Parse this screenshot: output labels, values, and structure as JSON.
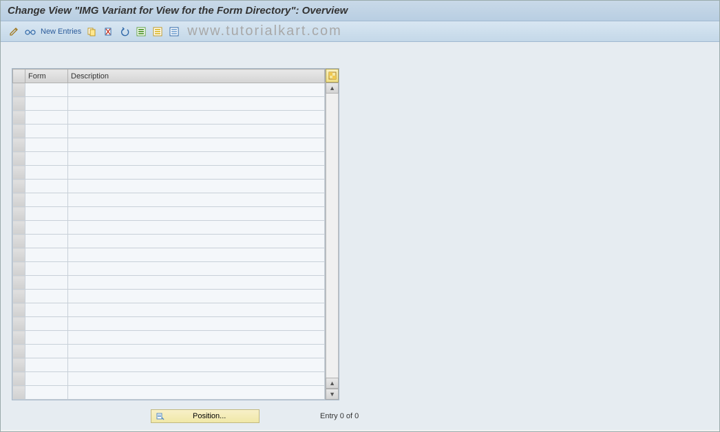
{
  "header": {
    "title": "Change View \"IMG Variant for View for the Form Directory\": Overview"
  },
  "toolbar": {
    "new_entries_label": "New Entries"
  },
  "watermark": "www.tutorialkart.com",
  "table": {
    "columns": {
      "form": "Form",
      "description": "Description"
    },
    "row_count": 23
  },
  "footer": {
    "position_label": "Position...",
    "entry_label": "Entry 0 of 0"
  }
}
